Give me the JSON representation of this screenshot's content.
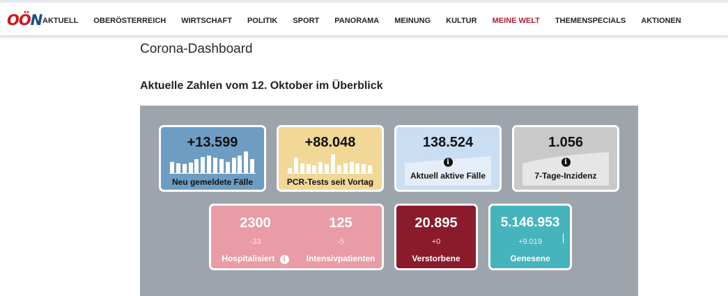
{
  "header": {
    "logo_part1": "OÖ",
    "logo_part2": "N",
    "nav": [
      {
        "label": "AKTUELL",
        "active": false
      },
      {
        "label": "OBERÖSTERREICH",
        "active": false
      },
      {
        "label": "WIRTSCHAFT",
        "active": false
      },
      {
        "label": "POLITIK",
        "active": false
      },
      {
        "label": "SPORT",
        "active": false
      },
      {
        "label": "PANORAMA",
        "active": false
      },
      {
        "label": "MEINUNG",
        "active": false
      },
      {
        "label": "KULTUR",
        "active": false
      },
      {
        "label": "MEINE WELT",
        "active": true
      },
      {
        "label": "THEMENSPECIALS",
        "active": false
      },
      {
        "label": "AKTIONEN",
        "active": false
      }
    ]
  },
  "page": {
    "title": "Corona-Dashboard",
    "subtitle": "Aktuelle Zahlen vom 12. Oktober im Überblick"
  },
  "cards": {
    "new_cases": {
      "value": "+13.599",
      "label": "Neu gemeldete Fälle",
      "color": "#6e9dc4",
      "trend": [
        0.45,
        0.4,
        0.35,
        0.42,
        0.55,
        0.65,
        0.7,
        0.6,
        0.55,
        0.45,
        0.6,
        0.7,
        0.85,
        0.55
      ]
    },
    "pcr_tests": {
      "value": "+88.048",
      "label": "PCR-Tests seit Vortag",
      "color": "#f2d897",
      "trend": [
        0.2,
        0.6,
        0.4,
        0.35,
        0.3,
        0.45,
        0.35,
        0.75,
        0.3,
        0.4,
        0.45,
        0.4,
        0.35,
        0.3
      ]
    },
    "active_cases": {
      "value": "138.524",
      "label": "Aktuell aktive Fälle",
      "info_icon": "info-icon",
      "color": "#c9def2"
    },
    "incidence": {
      "value": "1.056",
      "label": "7-Tage-Inzidenz",
      "info_icon": "info-icon",
      "color": "#c9c9c9"
    },
    "hospitalized": {
      "value": "2300",
      "delta": "-33",
      "label": "Hospitalisiert",
      "info_icon": "info-icon",
      "color": "#e99ca5"
    },
    "icu": {
      "value": "125",
      "delta": "-5",
      "label": "Intensivpatienten",
      "color": "#e99ca5"
    },
    "deaths": {
      "value": "20.895",
      "delta": "+0",
      "label": "Verstorbene",
      "color": "#8b1a2b"
    },
    "recovered": {
      "value": "5.146.953",
      "delta": "+9.019",
      "label": "Genesene",
      "color": "#45b4bd"
    }
  }
}
